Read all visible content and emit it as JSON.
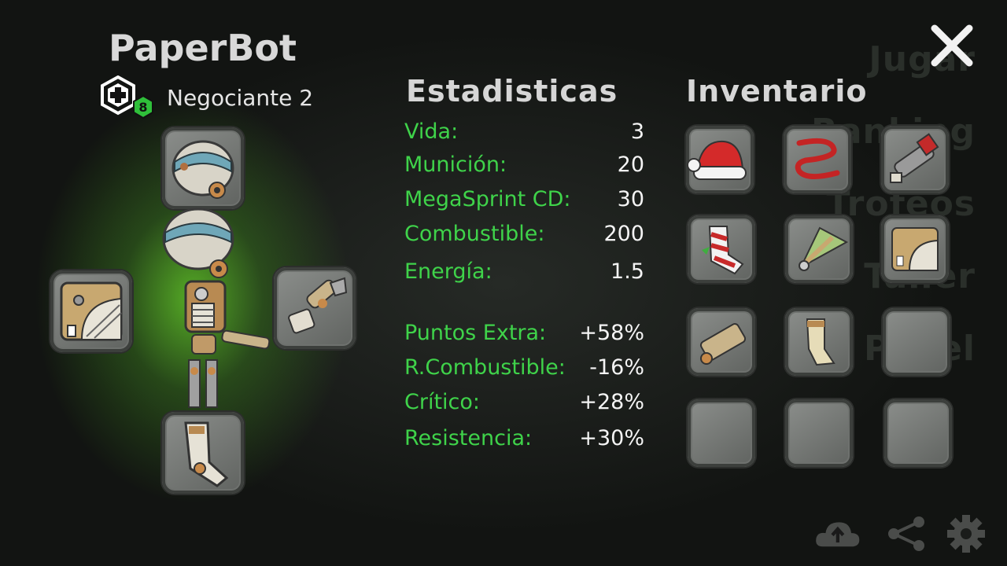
{
  "title": "PaperBot",
  "rank": {
    "level": "8",
    "name": "Negociante 2"
  },
  "stats_header": "Estadisticas",
  "inventory_header": "Inventario",
  "stats": [
    {
      "label": "Vida:",
      "value": "3"
    },
    {
      "label": "Munición:",
      "value": "20"
    },
    {
      "label": "MegaSprint CD:",
      "value": "30"
    },
    {
      "label": "Combustible:",
      "value": "200"
    },
    {
      "label": "Energía:",
      "value": "1.5"
    }
  ],
  "bonuses": [
    {
      "label": "Puntos Extra:",
      "value": "+58%"
    },
    {
      "label": "R.Combustible:",
      "value": "-16%"
    },
    {
      "label": "Crítico:",
      "value": "+28%"
    },
    {
      "label": "Resistencia:",
      "value": "+30%"
    }
  ],
  "background_menu": [
    "Jugar",
    "Ranking",
    "Trofeos",
    "Taller",
    "Panel"
  ],
  "inventory": [
    "santa-hat",
    "red-scarf",
    "arm-blaster",
    "candy-sock",
    "green-wing-part",
    "box-chest-part",
    "arm-cannon-part",
    "leg-part",
    "empty",
    "empty",
    "empty",
    "empty"
  ],
  "equipped": {
    "head": "robot-head",
    "left": "box-chest-part",
    "right": "arm-blaster",
    "bottom": "leg-part"
  },
  "colors": {
    "stat_label": "#3fd34a",
    "stat_value": "#f4f4f4",
    "glow": "#60c428",
    "rank_badge": "#2fbf3a"
  }
}
